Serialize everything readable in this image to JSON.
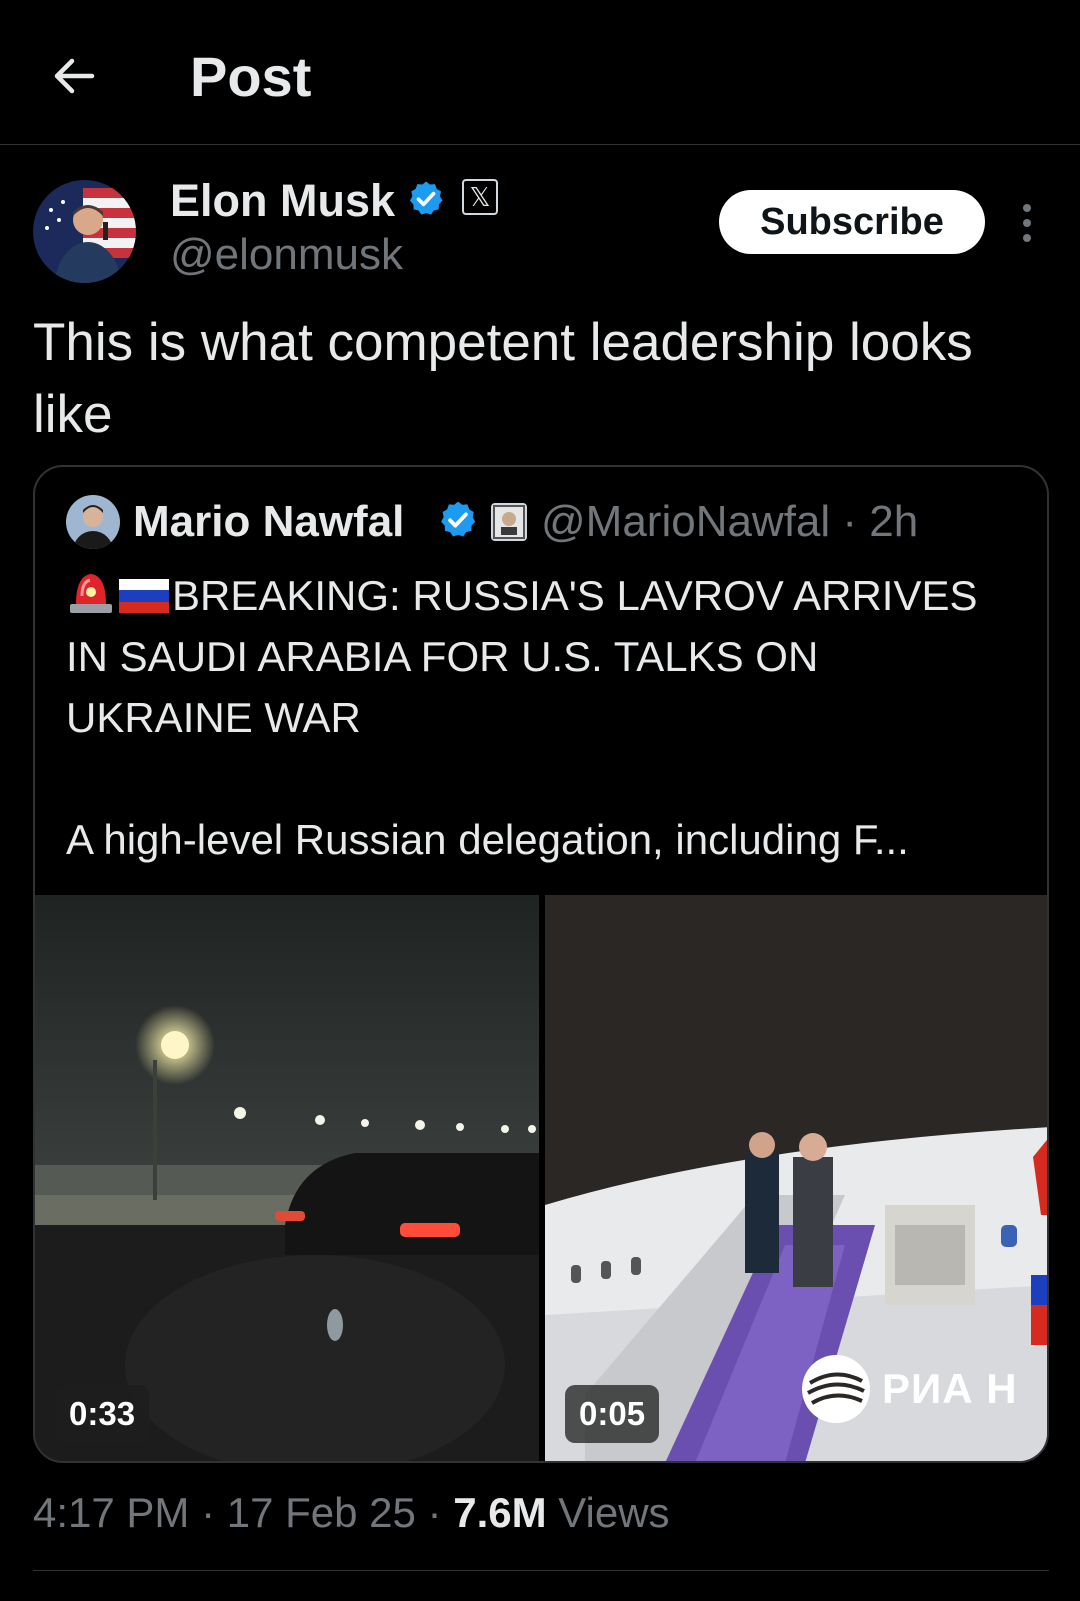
{
  "header": {
    "title": "Post"
  },
  "post": {
    "author": {
      "name": "Elon Musk",
      "handle": "@elonmusk"
    },
    "subscribe_label": "Subscribe",
    "text": "This is what competent leadership looks like",
    "timestamp": "4:17 PM · 17 Feb 25 · ",
    "views_count": "7.6M",
    "views_label": " Views"
  },
  "quote": {
    "author": {
      "name": "Mario Nawfal",
      "handle_time": "@MarioNawfal · 2h"
    },
    "text_lines": [
      "BREAKING: RUSSIA'S LAVROV ARRIVES",
      "IN SAUDI ARABIA FOR U.S. TALKS ON",
      "UKRAINE WAR",
      "A high-level Russian delegation, including F..."
    ],
    "media": [
      {
        "duration": "0:33"
      },
      {
        "duration": "0:05",
        "watermark": "РИА Н"
      }
    ]
  },
  "colors": {
    "background": "#000000",
    "text": "#e7e9ea",
    "muted": "#71767b",
    "verified": "#1d9bf0",
    "divider": "#2f3336"
  },
  "icons": [
    "back-arrow-icon",
    "verified-badge-icon",
    "x-logo-icon",
    "more-icon",
    "siren-icon",
    "russia-flag-icon"
  ]
}
